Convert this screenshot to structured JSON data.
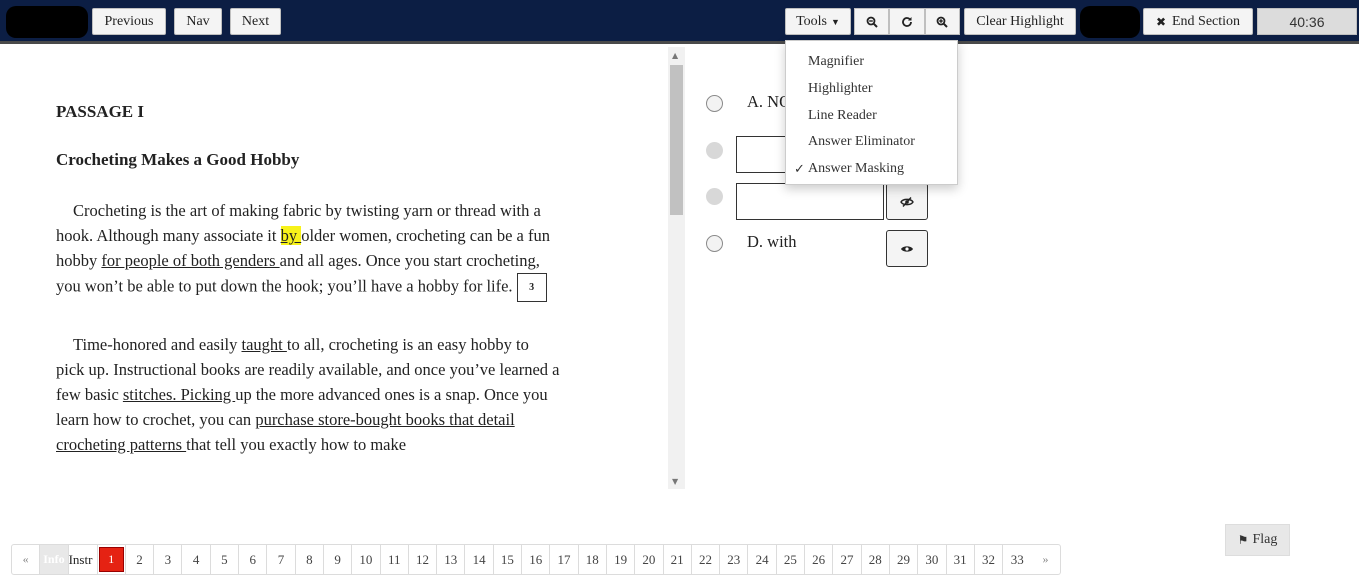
{
  "toolbar": {
    "previous_label": "Previous",
    "nav_label": "Nav",
    "next_label": "Next",
    "tools_label": "Tools",
    "clear_highlight_label": "Clear Highlight",
    "end_section_label": "End Section",
    "timer": "40:36"
  },
  "tools_menu": {
    "items": [
      "Magnifier",
      "Highlighter",
      "Line Reader",
      "Answer Eliminator",
      "Answer Masking"
    ],
    "checked_mark": "✓"
  },
  "passage": {
    "heading": "PASSAGE I",
    "title": "Crocheting Makes a Good Hobby",
    "p1": {
      "t1": "Crocheting is the art of making fabric by twisting yarn or thread with a hook. Although many associate it ",
      "hl": "by ",
      "t2": "older women, crocheting can be a fun hobby ",
      "u1": "for people of both genders ",
      "t3": "and all ages. Once you start crocheting, you won’t be able to put down the hook; you’ll have a hobby for life.",
      "box": "3"
    },
    "p2": {
      "t1": "Time-honored and easily ",
      "u1": "taught ",
      "t2": "to all, crocheting is an easy hobby to pick up. Instructional books are readily available, and once you’ve learned a few basic ",
      "u2": "stitches. Picking ",
      "t3": "up the more advanced ones is a snap. Once you learn how to crochet, you can ",
      "u3": "purchase store-bought books that detail crocheting patterns ",
      "t4": "that tell you exactly how to make"
    }
  },
  "answers": {
    "a": "A. NO CHANGE",
    "d": "D. with"
  },
  "flag_label": "Flag",
  "pager": {
    "prev": "«",
    "info": "Info",
    "instr": "Instr",
    "current": "1",
    "pages": [
      "2",
      "3",
      "4",
      "5",
      "6",
      "7",
      "8",
      "9",
      "10",
      "11",
      "12",
      "13",
      "14",
      "15",
      "16",
      "17",
      "18",
      "19",
      "20",
      "21",
      "22",
      "23",
      "24",
      "25",
      "26",
      "27",
      "28",
      "29",
      "30",
      "31",
      "32",
      "33"
    ],
    "next": "»"
  },
  "colors": {
    "topbar": "#0c1e44",
    "highlight": "#f7f21a",
    "current_page": "#e52213"
  }
}
